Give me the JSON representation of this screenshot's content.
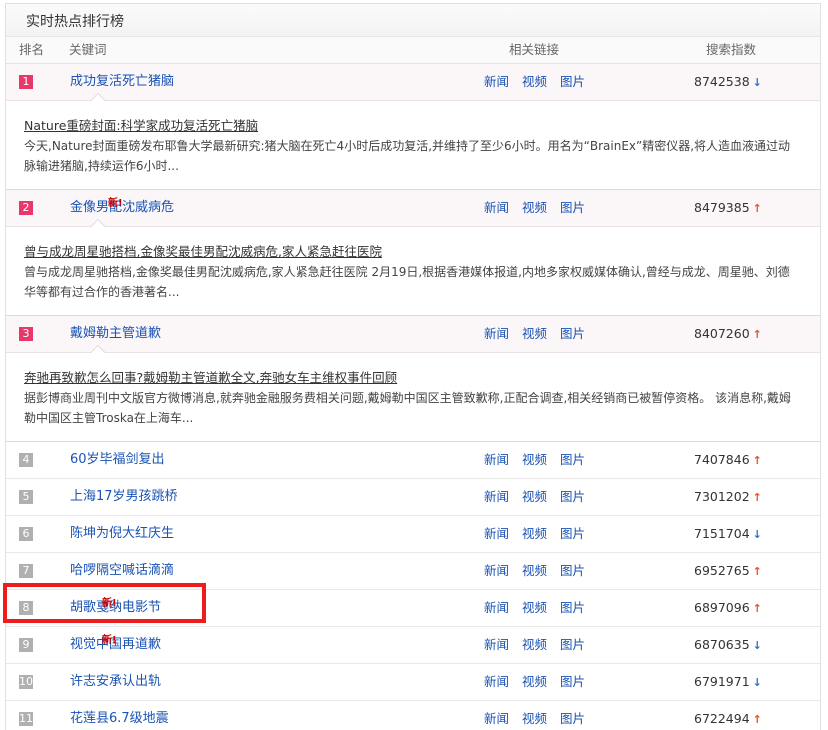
{
  "panel_title": "实时热点排行榜",
  "headers": {
    "rank": "排名",
    "keyword": "关键词",
    "links": "相关链接",
    "index": "搜索指数"
  },
  "link_labels": [
    "新闻",
    "视频",
    "图片"
  ],
  "new_badge": "新!",
  "highlight_color": "#ee1c1c",
  "rows": [
    {
      "rank": "1",
      "keyword": "成功复活死亡猪脑",
      "is_new": false,
      "index": "8742538",
      "trend": "down",
      "detail": {
        "title": "Nature重磅封面:科学家成功复活死亡猪脑",
        "summary": "今天,Nature封面重磅发布耶鲁大学最新研究:猪大脑在死亡4小时后成功复活,并维持了至少6小时。用名为“BrainEx”精密仪器,将人造血液通过动脉输进猪脑,持续运作6小时..."
      }
    },
    {
      "rank": "2",
      "keyword": "金像男配沈威病危",
      "is_new": true,
      "index": "8479385",
      "trend": "up",
      "detail": {
        "title": "曾与成龙周星驰搭档,金像奖最佳男配沈威病危,家人紧急赶往医院",
        "summary": "曾与成龙周星驰搭档,金像奖最佳男配沈威病危,家人紧急赶往医院 2月19日,根据香港媒体报道,内地多家权威媒体确认,曾经与成龙、周星驰、刘德华等都有过合作的香港著名..."
      }
    },
    {
      "rank": "3",
      "keyword": "戴姆勒主管道歉",
      "is_new": false,
      "index": "8407260",
      "trend": "up",
      "detail": {
        "title": "奔驰再致歉怎么回事?戴姆勒主管道歉全文,奔驰女车主维权事件回顾",
        "summary": "据彭博商业周刊中文版官方微博消息,就奔驰金融服务费相关问题,戴姆勒中国区主管致歉称,正配合调查,相关经销商已被暂停资格。 该消息称,戴姆勒中国区主管Troska在上海车..."
      }
    },
    {
      "rank": "4",
      "keyword": "60岁毕福剑复出",
      "is_new": false,
      "index": "7407846",
      "trend": "up"
    },
    {
      "rank": "5",
      "keyword": "上海17岁男孩跳桥",
      "is_new": false,
      "index": "7301202",
      "trend": "up"
    },
    {
      "rank": "6",
      "keyword": "陈坤为倪大红庆生",
      "is_new": false,
      "index": "7151704",
      "trend": "down"
    },
    {
      "rank": "7",
      "keyword": "哈啰隔空喊话滴滴",
      "is_new": false,
      "index": "6952765",
      "trend": "up"
    },
    {
      "rank": "8",
      "keyword": "胡歌戛纳电影节",
      "is_new": true,
      "index": "6897096",
      "trend": "up"
    },
    {
      "rank": "9",
      "keyword": "视觉中国再道歉",
      "is_new": true,
      "index": "6870635",
      "trend": "down"
    },
    {
      "rank": "10",
      "keyword": "许志安承认出轨",
      "is_new": false,
      "index": "6791971",
      "trend": "down"
    },
    {
      "rank": "11",
      "keyword": "花莲县6.7级地震",
      "is_new": false,
      "index": "6722494",
      "trend": "up"
    }
  ]
}
